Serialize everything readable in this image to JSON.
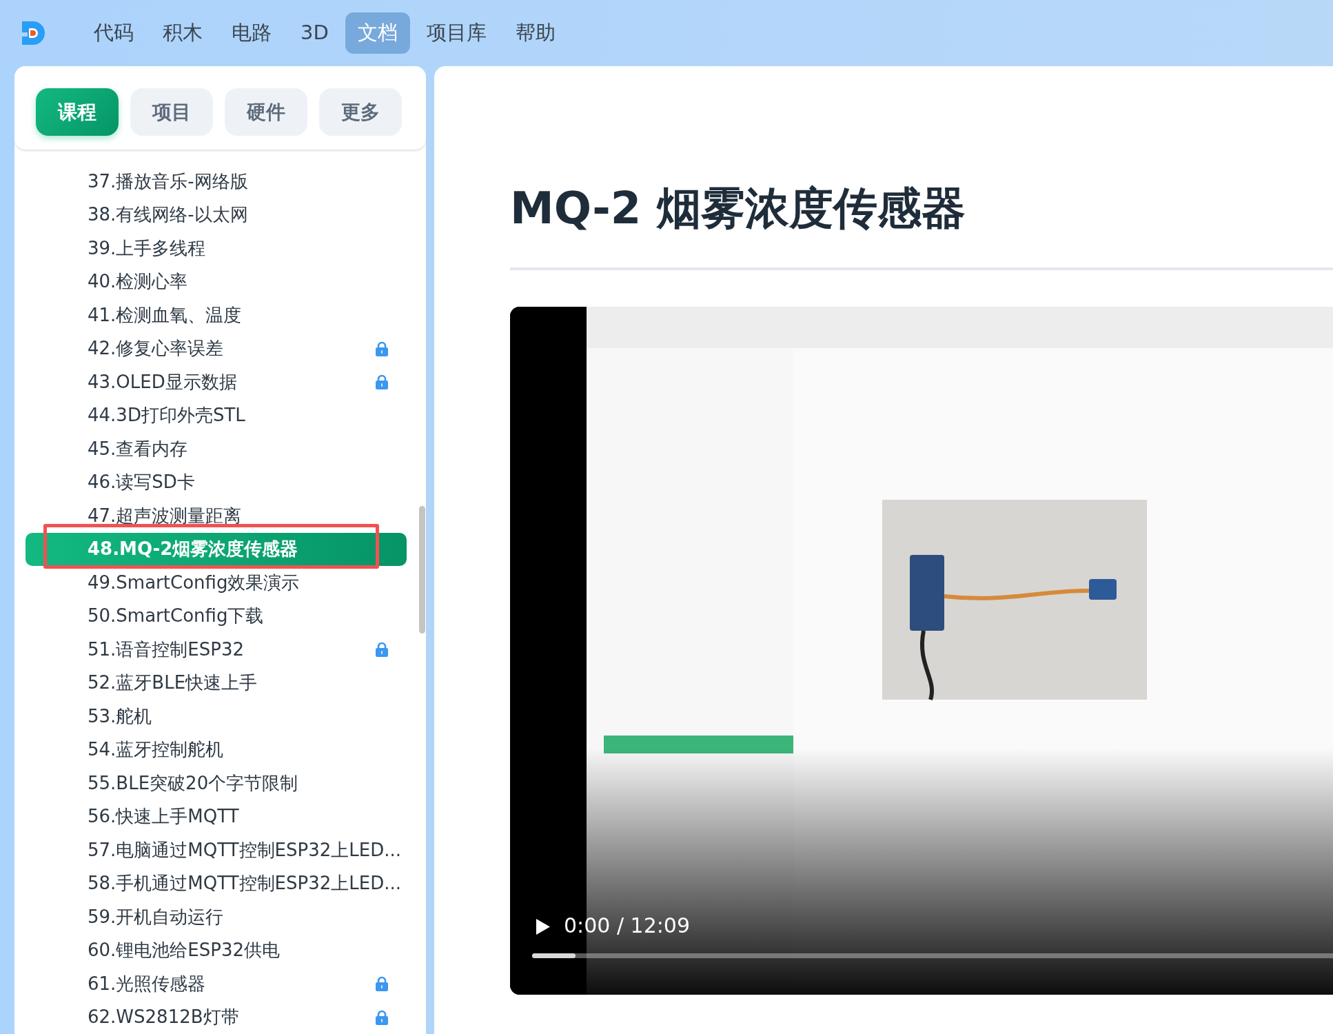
{
  "nav": {
    "items": [
      {
        "label": "代码",
        "selected": false
      },
      {
        "label": "积木",
        "selected": false
      },
      {
        "label": "电路",
        "selected": false
      },
      {
        "label": "3D",
        "selected": false
      },
      {
        "label": "文档",
        "selected": true
      },
      {
        "label": "项目库",
        "selected": false
      },
      {
        "label": "帮助",
        "selected": false
      }
    ]
  },
  "sidebar": {
    "tabs": [
      {
        "label": "课程",
        "selected": true
      },
      {
        "label": "项目",
        "selected": false
      },
      {
        "label": "硬件",
        "selected": false
      },
      {
        "label": "更多",
        "selected": false
      }
    ],
    "items": [
      {
        "label": "37.播放音乐-网络版",
        "selected": false,
        "locked": false,
        "highlighted": false
      },
      {
        "label": "38.有线网络-以太网",
        "selected": false,
        "locked": false,
        "highlighted": false
      },
      {
        "label": "39.上手多线程",
        "selected": false,
        "locked": false,
        "highlighted": false
      },
      {
        "label": "40.检测心率",
        "selected": false,
        "locked": false,
        "highlighted": false
      },
      {
        "label": "41.检测血氧、温度",
        "selected": false,
        "locked": false,
        "highlighted": false
      },
      {
        "label": "42.修复心率误差",
        "selected": false,
        "locked": true,
        "highlighted": false
      },
      {
        "label": "43.OLED显示数据",
        "selected": false,
        "locked": true,
        "highlighted": false
      },
      {
        "label": "44.3D打印外壳STL",
        "selected": false,
        "locked": false,
        "highlighted": false
      },
      {
        "label": "45.查看内存",
        "selected": false,
        "locked": false,
        "highlighted": false
      },
      {
        "label": "46.读写SD卡",
        "selected": false,
        "locked": false,
        "highlighted": false
      },
      {
        "label": "47.超声波测量距离",
        "selected": false,
        "locked": false,
        "highlighted": false
      },
      {
        "label": "48.MQ-2烟雾浓度传感器",
        "selected": true,
        "locked": false,
        "highlighted": true
      },
      {
        "label": "49.SmartConfig效果演示",
        "selected": false,
        "locked": false,
        "highlighted": false
      },
      {
        "label": "50.SmartConfig下载",
        "selected": false,
        "locked": false,
        "highlighted": false
      },
      {
        "label": "51.语音控制ESP32",
        "selected": false,
        "locked": true,
        "highlighted": false
      },
      {
        "label": "52.蓝牙BLE快速上手",
        "selected": false,
        "locked": false,
        "highlighted": false
      },
      {
        "label": "53.舵机",
        "selected": false,
        "locked": false,
        "highlighted": false
      },
      {
        "label": "54.蓝牙控制舵机",
        "selected": false,
        "locked": false,
        "highlighted": false
      },
      {
        "label": "55.BLE突破20个字节限制",
        "selected": false,
        "locked": false,
        "highlighted": false
      },
      {
        "label": "56.快速上手MQTT",
        "selected": false,
        "locked": false,
        "highlighted": false
      },
      {
        "label": "57.电脑通过MQTT控制ESP32上LED...",
        "selected": false,
        "locked": false,
        "highlighted": false
      },
      {
        "label": "58.手机通过MQTT控制ESP32上LED...",
        "selected": false,
        "locked": false,
        "highlighted": false
      },
      {
        "label": "59.开机自动运行",
        "selected": false,
        "locked": false,
        "highlighted": false
      },
      {
        "label": "60.锂电池给ESP32供电",
        "selected": false,
        "locked": false,
        "highlighted": false
      },
      {
        "label": "61.光照传感器",
        "selected": false,
        "locked": true,
        "highlighted": false
      },
      {
        "label": "62.WS2812B灯带",
        "selected": false,
        "locked": true,
        "highlighted": false
      }
    ]
  },
  "article": {
    "title": "MQ-2 烟雾浓度传感器",
    "video": {
      "kind": "picture",
      "time": "0:00 / 12:09",
      "level": 0.05
    }
  }
}
